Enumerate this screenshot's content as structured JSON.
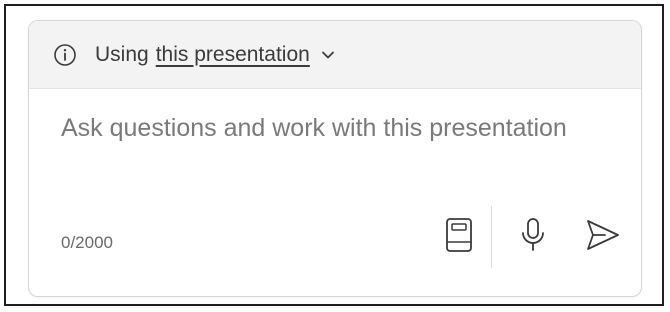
{
  "header": {
    "prefix": "Using",
    "context_label": "this presentation",
    "info_icon": "info-icon",
    "dropdown_icon": "chevron-down-icon"
  },
  "prompt": {
    "value": "",
    "placeholder": "Ask questions and work with this presentation"
  },
  "footer": {
    "char_count": "0/2000",
    "prompts_icon": "book-icon",
    "mic_icon": "microphone-icon",
    "send_icon": "send-icon"
  },
  "colors": {
    "header_bg": "#f3f3f3",
    "border": "#d6d6d6",
    "text": "#3b3b3b",
    "placeholder": "#7a7a7a"
  }
}
